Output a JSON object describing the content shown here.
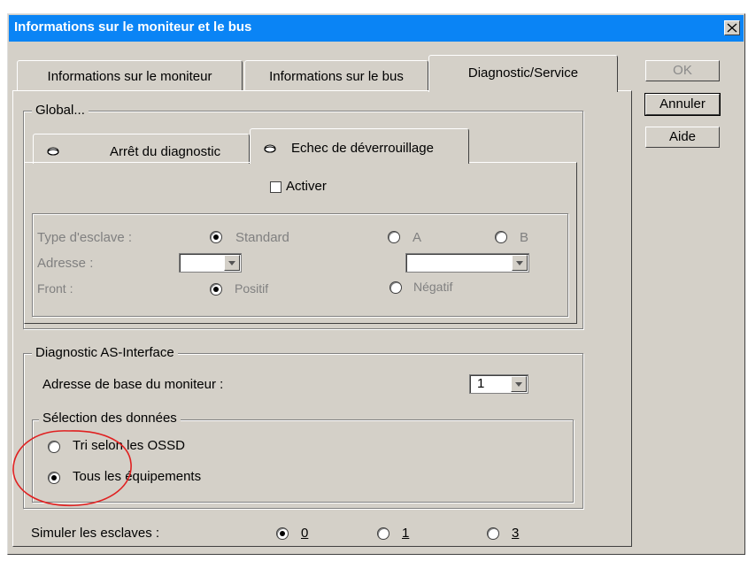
{
  "window": {
    "title": "Informations sur le moniteur et le bus"
  },
  "buttons": {
    "ok": "OK",
    "cancel": "Annuler",
    "help": "Aide"
  },
  "tabs": [
    {
      "label": "Informations sur le moniteur",
      "active": false
    },
    {
      "label": "Informations sur le bus",
      "active": false
    },
    {
      "label": "Diagnostic/Service",
      "active": true
    }
  ],
  "global": {
    "legend": "Global...",
    "subtabs": [
      {
        "label": "Arrêt du diagnostic",
        "icon": "disk-icon",
        "active": false
      },
      {
        "label": "Echec de déverrouillage",
        "icon": "disk-icon",
        "active": true
      }
    ],
    "activate_label": "Activer",
    "activate_checked": false,
    "slave_type_label": "Type d'esclave :",
    "slave_type_options": [
      {
        "label": "Standard",
        "selected": true
      },
      {
        "label": "A",
        "selected": false
      },
      {
        "label": "B",
        "selected": false
      }
    ],
    "address_label": "Adresse :",
    "address_value_1": "",
    "address_value_2": "",
    "edge_label": "Front :",
    "edge_options": [
      {
        "label": "Positif",
        "selected": true
      },
      {
        "label": "Négatif",
        "selected": false
      }
    ]
  },
  "diagnostic": {
    "legend": "Diagnostic AS-Interface",
    "base_address_label": "Adresse de base du moniteur :",
    "base_address_value": "1",
    "data_selection_legend": "Sélection des données",
    "data_options": [
      {
        "label": "Tri selon les OSSD",
        "selected": false
      },
      {
        "label": "Tous les équipements",
        "selected": true
      }
    ]
  },
  "simulate": {
    "label": "Simuler les esclaves :",
    "options": [
      {
        "label": "0",
        "selected": true
      },
      {
        "label": "1",
        "selected": false
      },
      {
        "label": "3",
        "selected": false
      }
    ]
  },
  "colors": {
    "titlebar": "#0a84f5",
    "dialog_bg": "#d4d0c8",
    "annotation_circle": "#e02020"
  }
}
